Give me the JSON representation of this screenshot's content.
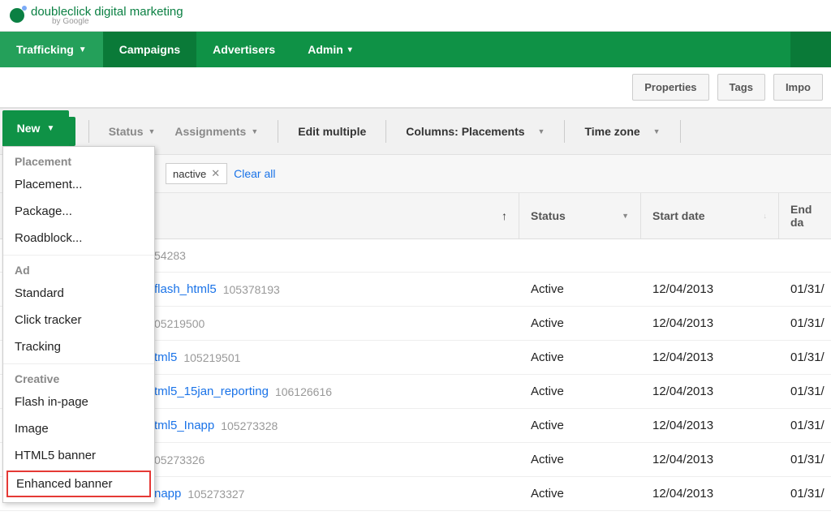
{
  "logo": {
    "text": "doubleclick digital marketing",
    "sub": "by Google"
  },
  "nav": {
    "trafficking": "Trafficking",
    "campaigns": "Campaigns",
    "advertisers": "Advertisers",
    "admin": "Admin"
  },
  "subbar": {
    "properties": "Properties",
    "tags": "Tags",
    "import": "Impo"
  },
  "toolbar": {
    "new": "New",
    "status": "Status",
    "assignments": "Assignments",
    "edit_multiple": "Edit multiple",
    "columns": "Columns: Placements",
    "timezone": "Time zone"
  },
  "filter": {
    "chip_label": "nactive",
    "clear": "Clear all"
  },
  "columns": {
    "name": "",
    "status": "Status",
    "start": "Start date",
    "end": "End da"
  },
  "totals_id": "54283",
  "rows": [
    {
      "name": "flash_html5",
      "id": "105378193",
      "status": "Active",
      "start": "12/04/2013",
      "end": "01/31/"
    },
    {
      "name": "",
      "id": "05219500",
      "status": "Active",
      "start": "12/04/2013",
      "end": "01/31/"
    },
    {
      "name": "tml5",
      "id": "105219501",
      "status": "Active",
      "start": "12/04/2013",
      "end": "01/31/"
    },
    {
      "name": "tml5_15jan_reporting",
      "id": "106126616",
      "status": "Active",
      "start": "12/04/2013",
      "end": "01/31/"
    },
    {
      "name": "tml5_Inapp",
      "id": "105273328",
      "status": "Active",
      "start": "12/04/2013",
      "end": "01/31/"
    },
    {
      "name": "",
      "id": "05273326",
      "status": "Active",
      "start": "12/04/2013",
      "end": "01/31/"
    },
    {
      "name": "napp",
      "id": "105273327",
      "status": "Active",
      "start": "12/04/2013",
      "end": "01/31/"
    }
  ],
  "dropdown": {
    "section_placement": "Placement",
    "placement": "Placement...",
    "package": "Package...",
    "roadblock": "Roadblock...",
    "section_ad": "Ad",
    "standard": "Standard",
    "click_tracker": "Click tracker",
    "tracking": "Tracking",
    "section_creative": "Creative",
    "flash_inpage": "Flash in-page",
    "image": "Image",
    "html5_banner": "HTML5 banner",
    "enhanced_banner": "Enhanced banner"
  }
}
